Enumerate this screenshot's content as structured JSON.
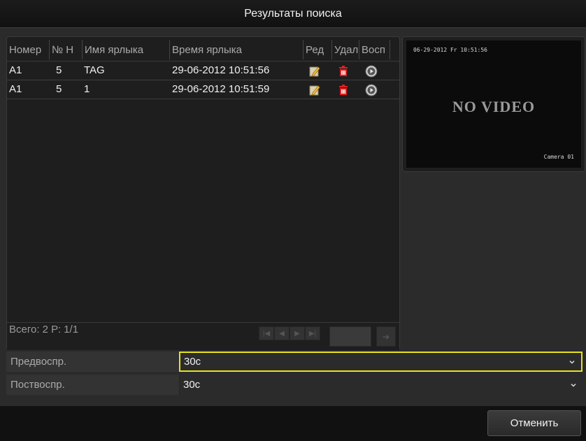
{
  "window": {
    "title": "Результаты поиска"
  },
  "table": {
    "columns": [
      "Номер",
      "№ Н",
      "Имя ярлыка",
      "Время ярлыка",
      "Ред",
      "Удал",
      "Восп"
    ],
    "rows": [
      {
        "number": "A1",
        "no": "5",
        "name": "TAG",
        "time": "29-06-2012 10:51:56"
      },
      {
        "number": "A1",
        "no": "5",
        "name": "1",
        "time": "29-06-2012 10:51:59"
      }
    ],
    "icons": {
      "edit": "edit-icon",
      "delete": "trash-icon",
      "play": "play-icon"
    }
  },
  "footer": {
    "summary": "Всего: 2  Р: 1/1",
    "pager_icons": [
      "first-page-icon",
      "prev-page-icon",
      "next-page-icon",
      "last-page-icon",
      "go-arrow-icon"
    ]
  },
  "preview": {
    "timestamp": "06-29-2012 Fr 10:51:56",
    "no_video": "NO VIDEO",
    "camera": "Camera 01"
  },
  "form": {
    "pre_label": "Предвоспр.",
    "pre_value": "30с",
    "post_label": "Поствоспр.",
    "post_value": "30с"
  },
  "actions": {
    "cancel_label": "Отменить"
  },
  "colors": {
    "accent_focus": "#e6e221",
    "delete_icon": "#e02020",
    "edit_icon": "#f0c040",
    "panel": "#1e1e1e"
  }
}
